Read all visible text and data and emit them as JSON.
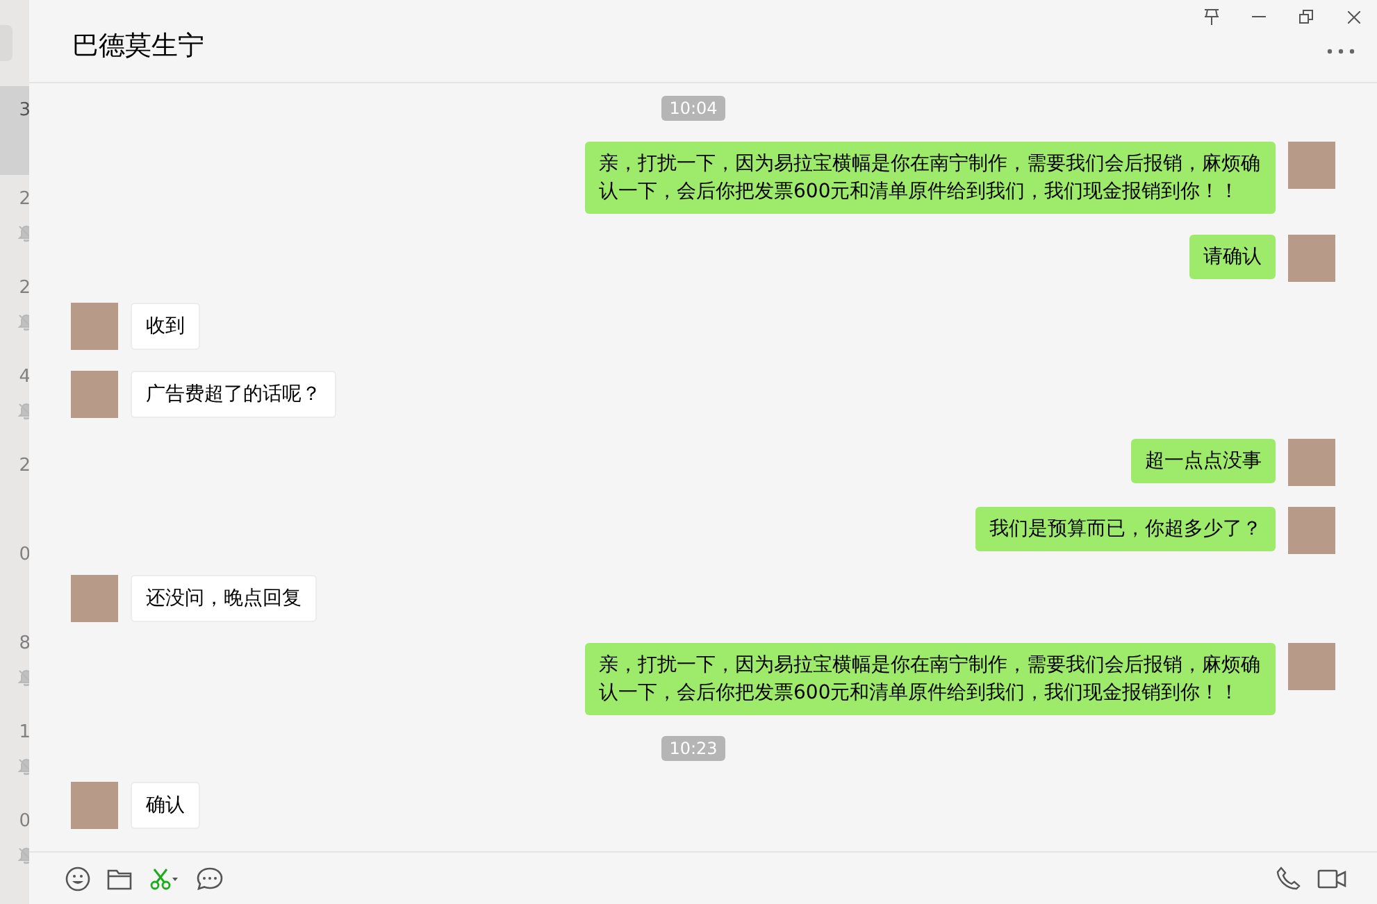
{
  "sidebar": {
    "items": [
      {
        "time": "3",
        "muted": false,
        "selected": true
      },
      {
        "time": "2",
        "muted": true,
        "selected": false
      },
      {
        "time": "2",
        "muted": true,
        "selected": false
      },
      {
        "time": "4",
        "muted": true,
        "selected": false
      },
      {
        "time": "2",
        "muted": false,
        "selected": false
      },
      {
        "time": "0",
        "muted": false,
        "selected": false
      },
      {
        "time": "8",
        "muted": true,
        "selected": false
      },
      {
        "time": "1",
        "muted": true,
        "selected": false
      },
      {
        "time": "0",
        "muted": true,
        "selected": false
      }
    ]
  },
  "chat": {
    "title": "巴德莫生宁"
  },
  "messages": [
    {
      "kind": "time",
      "text": "10:04"
    },
    {
      "kind": "sent",
      "text": "亲，打扰一下，因为易拉宝横幅是你在南宁制作，需要我们会后报销，麻烦确认一下，会后你把发票600元和清单原件给到我们，我们现金报销到你！！"
    },
    {
      "kind": "sent",
      "text": "请确认"
    },
    {
      "kind": "received",
      "text": "收到"
    },
    {
      "kind": "received",
      "text": "广告费超了的话呢？"
    },
    {
      "kind": "sent",
      "text": "超一点点没事"
    },
    {
      "kind": "sent",
      "text": "我们是预算而已，你超多少了？"
    },
    {
      "kind": "received",
      "text": "还没问，晚点回复"
    },
    {
      "kind": "sent",
      "text": "亲，打扰一下，因为易拉宝横幅是你在南宁制作，需要我们会后报销，麻烦确认一下，会后你把发票600元和清单原件给到我们，我们现金报销到你！！"
    },
    {
      "kind": "time",
      "text": "10:23"
    },
    {
      "kind": "received",
      "text": "确认"
    }
  ]
}
